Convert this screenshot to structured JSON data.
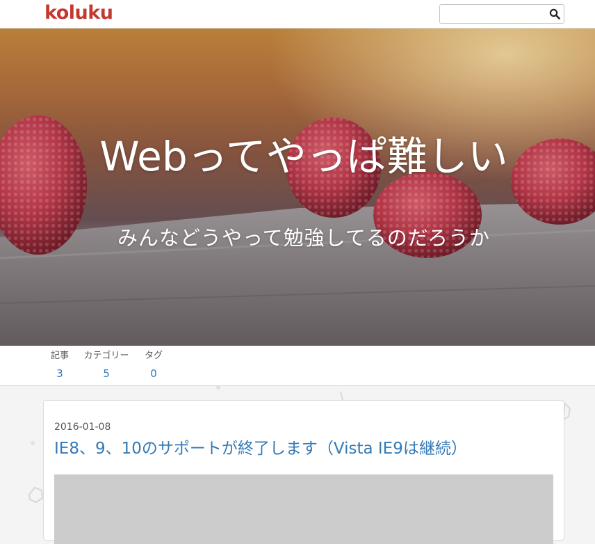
{
  "header": {
    "logo_text": "koluku",
    "search_placeholder": "",
    "search_icon": "magnifier-icon"
  },
  "hero": {
    "title": "Webってやっぱ難しい",
    "subtitle": "みんなどうやって勉強してるのだろうか"
  },
  "stats": [
    {
      "label": "記事",
      "value": "3"
    },
    {
      "label": "カテゴリー",
      "value": "5"
    },
    {
      "label": "タグ",
      "value": "0"
    }
  ],
  "post": {
    "date": "2016-01-08",
    "title": "IE8、9、10のサポートが終了します（Vista IE9は継続）"
  },
  "colors": {
    "brand": "#c4392f",
    "link": "#337ab7",
    "page_bg": "#f4f4f4"
  }
}
